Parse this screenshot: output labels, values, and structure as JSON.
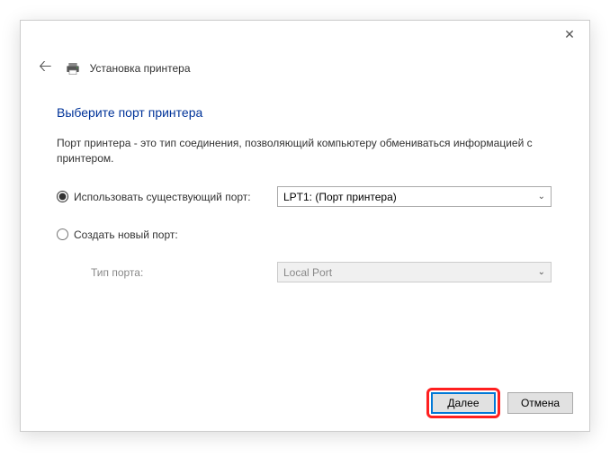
{
  "header": {
    "title": "Установка принтера"
  },
  "page": {
    "title": "Выберите порт принтера",
    "description": "Порт принтера - это тип соединения, позволяющий компьютеру обмениваться информацией с принтером."
  },
  "options": {
    "use_existing": {
      "label": "Использовать существующий порт:",
      "selected": "LPT1: (Порт принтера)"
    },
    "create_new": {
      "label": "Создать новый порт:",
      "type_label": "Тип порта:",
      "selected": "Local Port"
    }
  },
  "footer": {
    "next": "Далее",
    "cancel": "Отмена"
  }
}
